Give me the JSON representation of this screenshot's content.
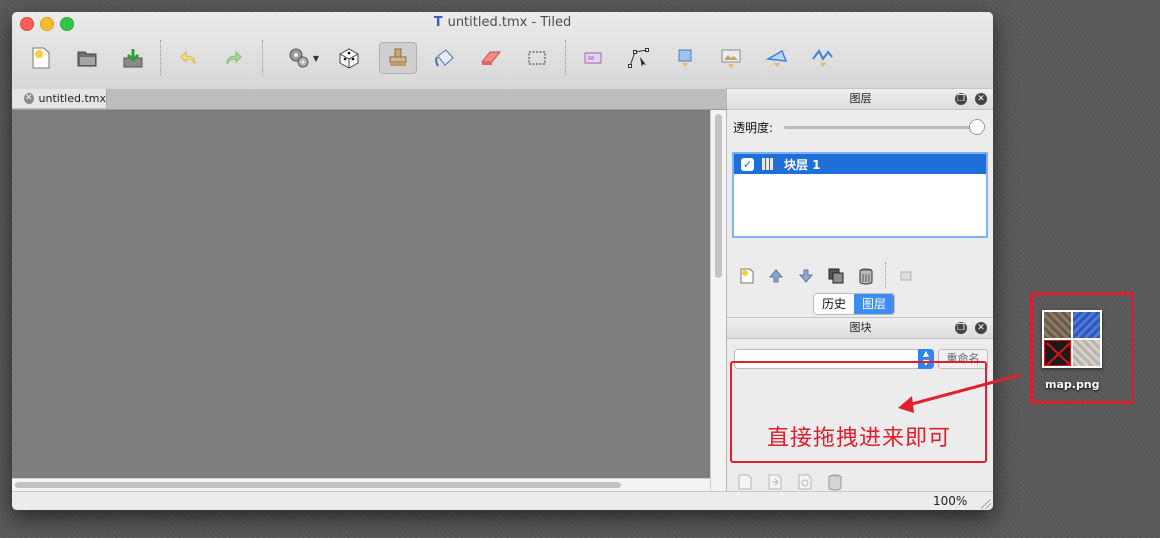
{
  "window": {
    "title": "untitled.tmx - Tiled"
  },
  "toolbar": {
    "icons": [
      "new-map-icon",
      "open-icon",
      "save-icon",
      "undo-icon",
      "redo-icon",
      "commands-icon",
      "random-mode-icon",
      "stamp-brush-icon",
      "bucket-fill-icon",
      "eraser-icon",
      "rect-select-icon",
      "insert-tile-icon",
      "edit-polygon-icon",
      "insert-rect-icon",
      "insert-image-icon",
      "insert-polygon-icon",
      "insert-polyline-icon"
    ]
  },
  "document": {
    "tab_label": "untitled.tmx",
    "zoom": "100%"
  },
  "layers_panel": {
    "title": "图层",
    "opacity_label": "透明度:",
    "opacity": 1.0,
    "layers": [
      {
        "name": "块层 1",
        "visible": true,
        "selected": true
      }
    ]
  },
  "dock_tabs": {
    "history": "历史",
    "layers": "图层",
    "active": "图层"
  },
  "tilesets_panel": {
    "title": "图块",
    "rename_label": "重命名",
    "selected_value": ""
  },
  "annotation": {
    "text": "直接拖拽进来即可",
    "color": "#e0202c"
  },
  "desktop_file": {
    "name": "map.png"
  }
}
